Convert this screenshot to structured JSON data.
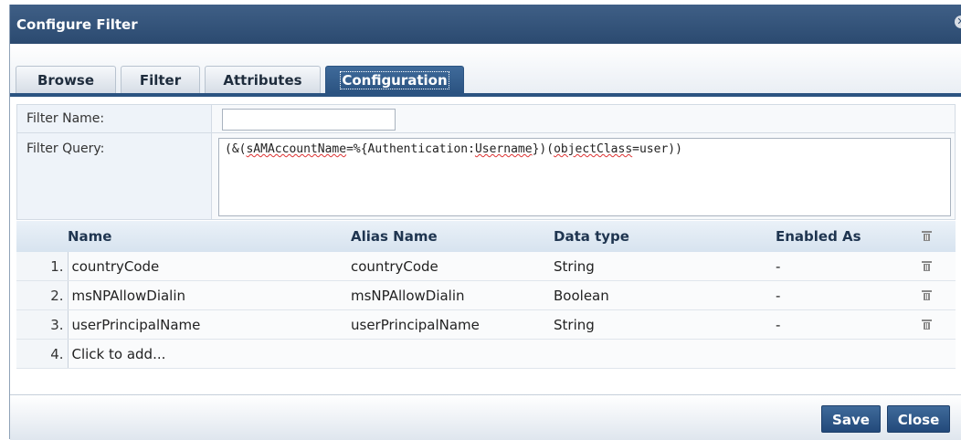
{
  "dialog": {
    "title": "Configure Filter"
  },
  "tabs": [
    {
      "label": "Browse"
    },
    {
      "label": "Filter"
    },
    {
      "label": "Attributes"
    },
    {
      "label": "Configuration"
    }
  ],
  "form": {
    "filter_name_label": "Filter Name:",
    "filter_name_value": "",
    "filter_query_label": "Filter Query:",
    "filter_query_parts": [
      "(&(",
      "sAMAccountName",
      "=%{Authentication:",
      "Username",
      "})(",
      "objectClass",
      "=user))"
    ]
  },
  "table": {
    "headers": {
      "name": "Name",
      "alias": "Alias Name",
      "type": "Data type",
      "enabled": "Enabled As"
    },
    "rows": [
      {
        "num": "1.",
        "name": "countryCode",
        "alias": "countryCode",
        "type": "String",
        "enabled": "-"
      },
      {
        "num": "2.",
        "name": "msNPAllowDialin",
        "alias": "msNPAllowDialin",
        "type": "Boolean",
        "enabled": "-"
      },
      {
        "num": "3.",
        "name": "userPrincipalName",
        "alias": "userPrincipalName",
        "type": "String",
        "enabled": "-"
      }
    ],
    "add_row": {
      "num": "4.",
      "label": "Click to add..."
    }
  },
  "footer": {
    "save_label": "Save",
    "close_label": "Close"
  }
}
